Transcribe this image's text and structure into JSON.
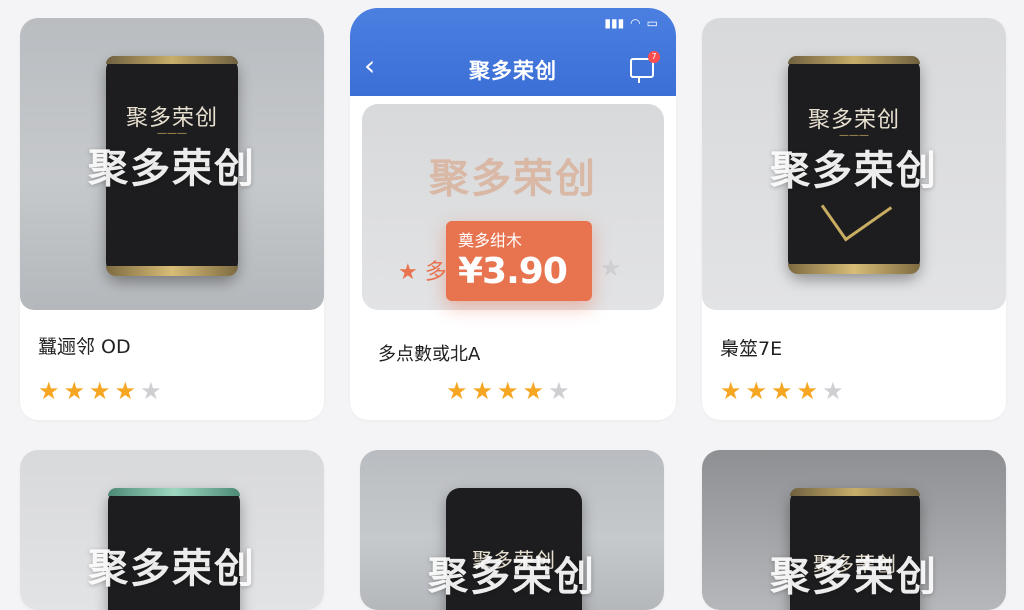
{
  "header": {
    "title": "聚多荣创",
    "back_icon": "chevron-left-icon",
    "message_icon": "message-icon",
    "message_badge": "7",
    "status_icons": [
      "signal-icon",
      "wifi-icon",
      "battery-icon"
    ],
    "accent_color": "#4b7fe0"
  },
  "watermark": "聚多荣创",
  "pack_brand": "聚多荣创",
  "products": [
    {
      "title": "蠶逦邻 OD",
      "rating": 4,
      "max_rating": 5
    },
    {
      "title": "多点數或北A",
      "rating": 4,
      "max_rating": 5,
      "tag_text": "奠多绀木",
      "price": "¥3.90",
      "side_label": "★ 多",
      "price_color": "#e8734f"
    },
    {
      "title": "梟筮7E",
      "rating": 4,
      "max_rating": 5
    }
  ],
  "rating_colors": {
    "on": "#f5a623",
    "off": "#cfcfd3"
  }
}
